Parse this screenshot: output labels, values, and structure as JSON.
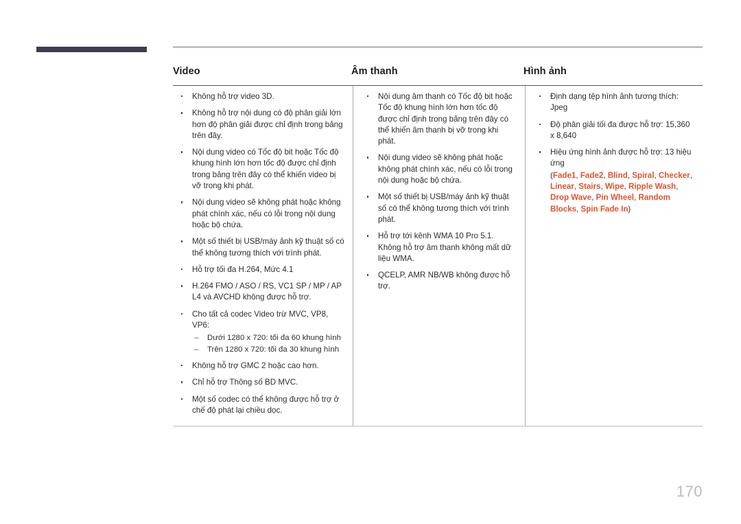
{
  "page": {
    "number": "170",
    "accent_color": "#e0522c",
    "tab_color": "#413b4d"
  },
  "table": {
    "columns": [
      {
        "heading": "Video",
        "items": [
          {
            "text": "Không hỗ trợ video 3D."
          },
          {
            "text": "Không hỗ trợ nội dung có độ phân giải lớn hơn độ phân giải được chỉ định trong bảng trên đây."
          },
          {
            "text": "Nội dung video có Tốc độ bit hoặc Tốc độ khung hình lớn hơn tốc độ được chỉ định trong bảng trên đây có thể khiến video bị vỡ trong khi phát."
          },
          {
            "text": "Nội dung video sẽ không phát hoặc không phát chính xác, nếu có lỗi trong nội dung hoặc bộ chứa."
          },
          {
            "text": "Một số thiết bị USB/máy ảnh kỹ thuật số có thể không tương thích với trình phát."
          },
          {
            "text": "Hỗ trợ tối đa H.264, Mức 4.1"
          },
          {
            "text": "H.264 FMO / ASO / RS, VC1 SP / MP / AP L4 và AVCHD không được hỗ trợ."
          },
          {
            "text": "Cho tất cả codec Video trừ MVC, VP8, VP6:",
            "subitems": [
              {
                "dash": "–",
                "text": "Dưới 1280 x 720: tối đa 60 khung hình"
              },
              {
                "dash": "–",
                "text": "Trên 1280 x 720: tối đa 30 khung hình"
              }
            ]
          },
          {
            "text": "Không hỗ trợ GMC 2 hoặc cao hơn."
          },
          {
            "text": "Chỉ hỗ trợ Thông số BD MVC."
          },
          {
            "text": "Một số codec có thể không được hỗ trợ ở chế độ phát lại chiều dọc."
          }
        ]
      },
      {
        "heading": "Âm thanh",
        "items": [
          {
            "text": "Nội dung âm thanh có Tốc độ bit hoặc Tốc độ khung hình lớn hơn tốc độ được chỉ định trong bảng trên đây có thể khiến âm thanh bị vỡ trong khi phát."
          },
          {
            "text": "Nội dung video sẽ không phát hoặc không phát chính xác, nếu có lỗi trong nội dung hoặc bộ chứa."
          },
          {
            "text": "Một số thiết bị USB/máy ảnh kỹ thuật số có thể không tương thích với trình phát."
          },
          {
            "text": "Hỗ trợ tới kênh WMA 10 Pro 5.1. Không hỗ trợ âm thanh không mất dữ liệu WMA."
          },
          {
            "text": "QCELP, AMR NB/WB không được hỗ trợ."
          }
        ]
      },
      {
        "heading": "Hình ảnh",
        "items": [
          {
            "text": "Định dạng tệp hình ảnh tương thích: Jpeg"
          },
          {
            "text": "Độ phân giải tối đa được hỗ trợ: 15,360 x 8,640"
          },
          {
            "text": "Hiệu ứng hình ảnh được hỗ trợ: 13 hiệu ứng",
            "effects_prefix": "(",
            "effects": [
              "Fade1",
              "Fade2",
              "Blind",
              "Spiral",
              "Checker",
              "Linear",
              "Stairs",
              "Wipe",
              "Ripple Wash",
              "Drop Wave",
              "Pin Wheel",
              "Random Blocks",
              "Spin Fade In"
            ],
            "effects_separator": ", ",
            "effects_suffix": ")"
          }
        ]
      }
    ]
  }
}
